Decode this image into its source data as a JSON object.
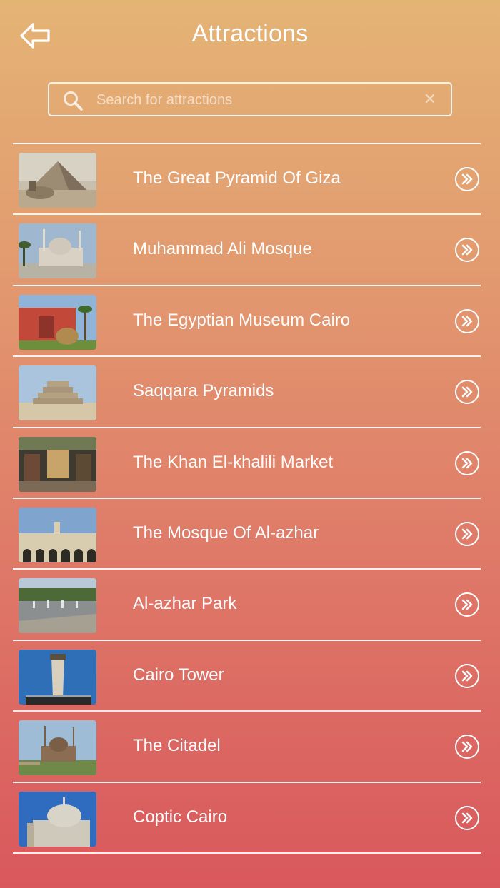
{
  "header": {
    "title": "Attractions",
    "back_icon": "back-arrow-icon"
  },
  "search": {
    "placeholder": "Search for attractions",
    "value": "",
    "icon": "search-icon",
    "clear_icon": "clear-icon"
  },
  "attractions": [
    {
      "label": "The Great Pyramid Of Giza",
      "thumb": "pyramid"
    },
    {
      "label": "Muhammad Ali Mosque",
      "thumb": "mosque"
    },
    {
      "label": "The Egyptian Museum Cairo",
      "thumb": "museum"
    },
    {
      "label": "Saqqara Pyramids",
      "thumb": "step-pyramid"
    },
    {
      "label": "The Khan El-khalili Market",
      "thumb": "market"
    },
    {
      "label": "The Mosque Of Al-azhar",
      "thumb": "arcade"
    },
    {
      "label": "Al-azhar Park",
      "thumb": "park"
    },
    {
      "label": "Cairo Tower",
      "thumb": "tower"
    },
    {
      "label": "The Citadel",
      "thumb": "citadel"
    },
    {
      "label": "Coptic Cairo",
      "thumb": "dome"
    }
  ],
  "row_icon": "double-chevron-right-icon"
}
